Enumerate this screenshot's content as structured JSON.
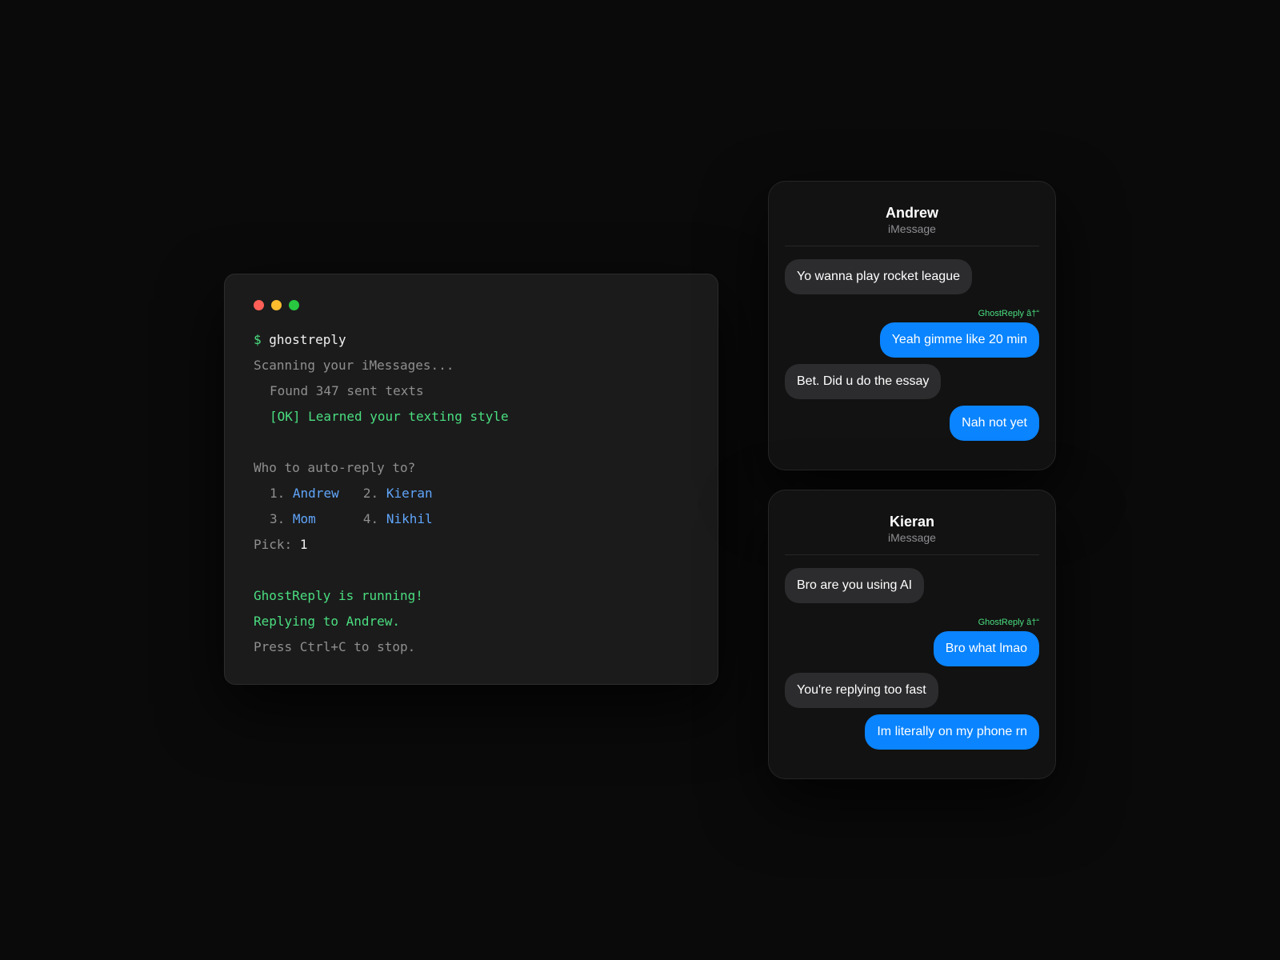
{
  "terminal": {
    "prompt_symbol": "$",
    "command": "ghostreply",
    "scanning": "Scanning your iMessages...",
    "found": "Found 347 sent texts",
    "ok_line": "[OK] Learned your texting style",
    "question": "Who to auto-reply to?",
    "options": [
      {
        "num": "1.",
        "name": "Andrew"
      },
      {
        "num": "2.",
        "name": "Kieran"
      },
      {
        "num": "3.",
        "name": "Mom"
      },
      {
        "num": "4.",
        "name": "Nikhil"
      }
    ],
    "pick_label": "Pick:",
    "pick_value": "1",
    "running": "GhostReply is running!",
    "replying": "Replying to Andrew.",
    "stop_hint": "Press Ctrl+C to stop."
  },
  "chats": [
    {
      "name": "Andrew",
      "service": "iMessage",
      "messages": [
        {
          "dir": "in",
          "text": "Yo wanna play rocket league"
        },
        {
          "dir": "out",
          "tag": "GhostReply â†“",
          "text": "Yeah gimme like 20 min"
        },
        {
          "dir": "in",
          "text": "Bet. Did u do the essay"
        },
        {
          "dir": "out",
          "text": "Nah not yet"
        }
      ]
    },
    {
      "name": "Kieran",
      "service": "iMessage",
      "messages": [
        {
          "dir": "in",
          "text": "Bro are you using AI"
        },
        {
          "dir": "out",
          "tag": "GhostReply â†“",
          "text": "Bro what lmao"
        },
        {
          "dir": "in",
          "text": "You're replying too fast"
        },
        {
          "dir": "out",
          "text": "Im literally on my phone rn"
        }
      ]
    }
  ],
  "colors": {
    "background": "#0a0a0a",
    "terminal_bg": "#1b1b1b",
    "green": "#4ade80",
    "blue_link": "#60a5fa",
    "bubble_out": "#0a84ff",
    "bubble_in": "#2c2c2e"
  }
}
